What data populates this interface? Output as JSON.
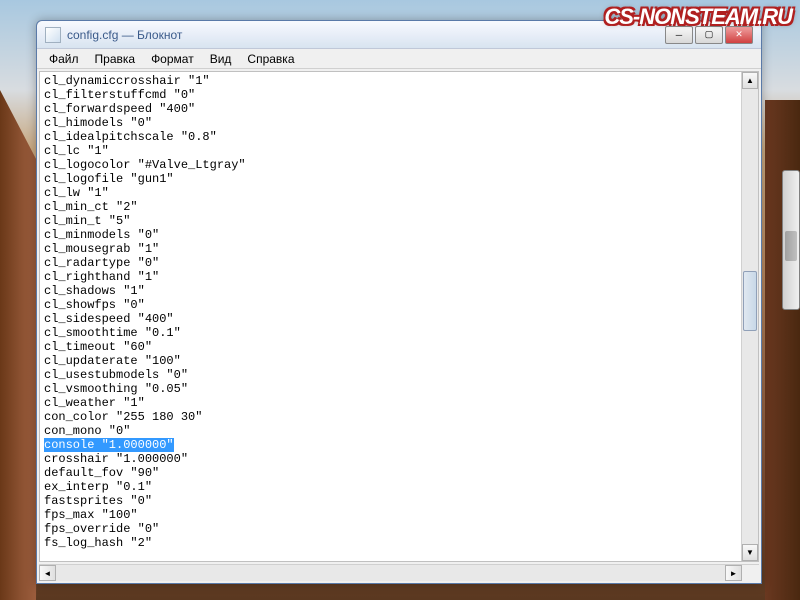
{
  "watermark": "CS-NONSTEAM.RU",
  "window": {
    "title": "config.cfg — Блокнот"
  },
  "menu": {
    "file": "Файл",
    "edit": "Правка",
    "format": "Формат",
    "view": "Вид",
    "help": "Справка"
  },
  "config_lines": [
    "cl_dynamiccrosshair \"1\"",
    "cl_filterstuffcmd \"0\"",
    "cl_forwardspeed \"400\"",
    "cl_himodels \"0\"",
    "cl_idealpitchscale \"0.8\"",
    "cl_lc \"1\"",
    "cl_logocolor \"#Valve_Ltgray\"",
    "cl_logofile \"gun1\"",
    "cl_lw \"1\"",
    "cl_min_ct \"2\"",
    "cl_min_t \"5\"",
    "cl_minmodels \"0\"",
    "cl_mousegrab \"1\"",
    "cl_radartype \"0\"",
    "cl_righthand \"1\"",
    "cl_shadows \"1\"",
    "cl_showfps \"0\"",
    "cl_sidespeed \"400\"",
    "cl_smoothtime \"0.1\"",
    "cl_timeout \"60\"",
    "cl_updaterate \"100\"",
    "cl_usestubmodels \"0\"",
    "cl_vsmoothing \"0.05\"",
    "cl_weather \"1\"",
    "con_color \"255 180 30\"",
    "con_mono \"0\""
  ],
  "highlighted_line": "console \"1.000000\"",
  "config_lines_after": [
    "crosshair \"1.000000\"",
    "default_fov \"90\"",
    "ex_interp \"0.1\"",
    "fastsprites \"0\"",
    "fps_max \"100\"",
    "fps_override \"0\"",
    "fs_log_hash \"2\""
  ]
}
